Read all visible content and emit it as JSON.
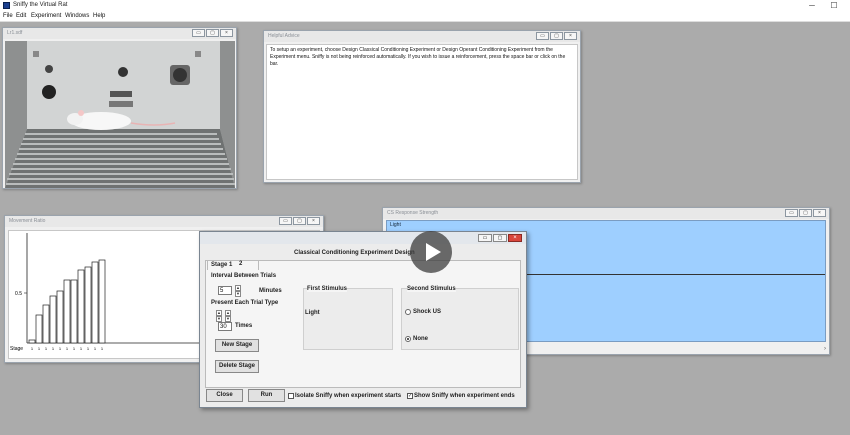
{
  "app": {
    "title": "Sniffy the Virtual Rat",
    "minimize": "─",
    "maximize": "☐"
  },
  "menu": [
    "File",
    "Edit",
    "Experiment",
    "Windows",
    "Help"
  ],
  "windows": {
    "cage": {
      "title": "Lr1.sdf"
    },
    "advice": {
      "title": "Helpful Advice",
      "text": "To setup an experiment, choose Design Classical Conditioning Experiment or Design Operant Conditioning Experiment from the Experiment menu.   Sniffy is not being reinforced automatically. If you wish to issue a reinforcement, press the space bar or click on the bar."
    },
    "movement": {
      "title": "Movement Ratio",
      "y_tick": "0.5",
      "x_label": "Stage",
      "stage_ticks": [
        "1",
        "1",
        "1",
        "1",
        "1",
        "1",
        "1",
        "1",
        "1",
        "1",
        "1"
      ]
    },
    "cs": {
      "title": "CS Response Strength",
      "tab": "Light"
    }
  },
  "chart_data": {
    "type": "bar",
    "title": "Movement Ratio",
    "xlabel": "Stage",
    "ylabel": "",
    "categories": [
      "1",
      "1",
      "1",
      "1",
      "1",
      "1",
      "1",
      "1",
      "1",
      "1",
      "1"
    ],
    "values": [
      0.03,
      0.28,
      0.38,
      0.47,
      0.52,
      0.63,
      0.63,
      0.73,
      0.76,
      0.81,
      0.83
    ],
    "ylim": [
      0,
      1
    ],
    "y_ticks": [
      0.5
    ]
  },
  "dialog": {
    "title": "Classical Conditioning Experiment Design",
    "tabs": [
      "Stage 1",
      "2"
    ],
    "interval_label": "Interval Between Trials",
    "interval_value": "5",
    "minutes_label": "Minutes",
    "present_label": "Present Each Trial Type",
    "times_value": "30",
    "times_label": "Times",
    "new_stage": "New Stage",
    "delete_stage": "Delete Stage",
    "first_stimulus_title": "First Stimulus",
    "first_stimulus_value": "Light",
    "second_stimulus_title": "Second Stimulus",
    "shock_label": "Shock US",
    "none_label": "None",
    "close": "Close",
    "run": "Run",
    "isolate_label": "Isolate Sniffy when experiment starts",
    "show_label": "Show Sniffy when experiment ends",
    "isolate_checked": false,
    "show_checked": true
  }
}
